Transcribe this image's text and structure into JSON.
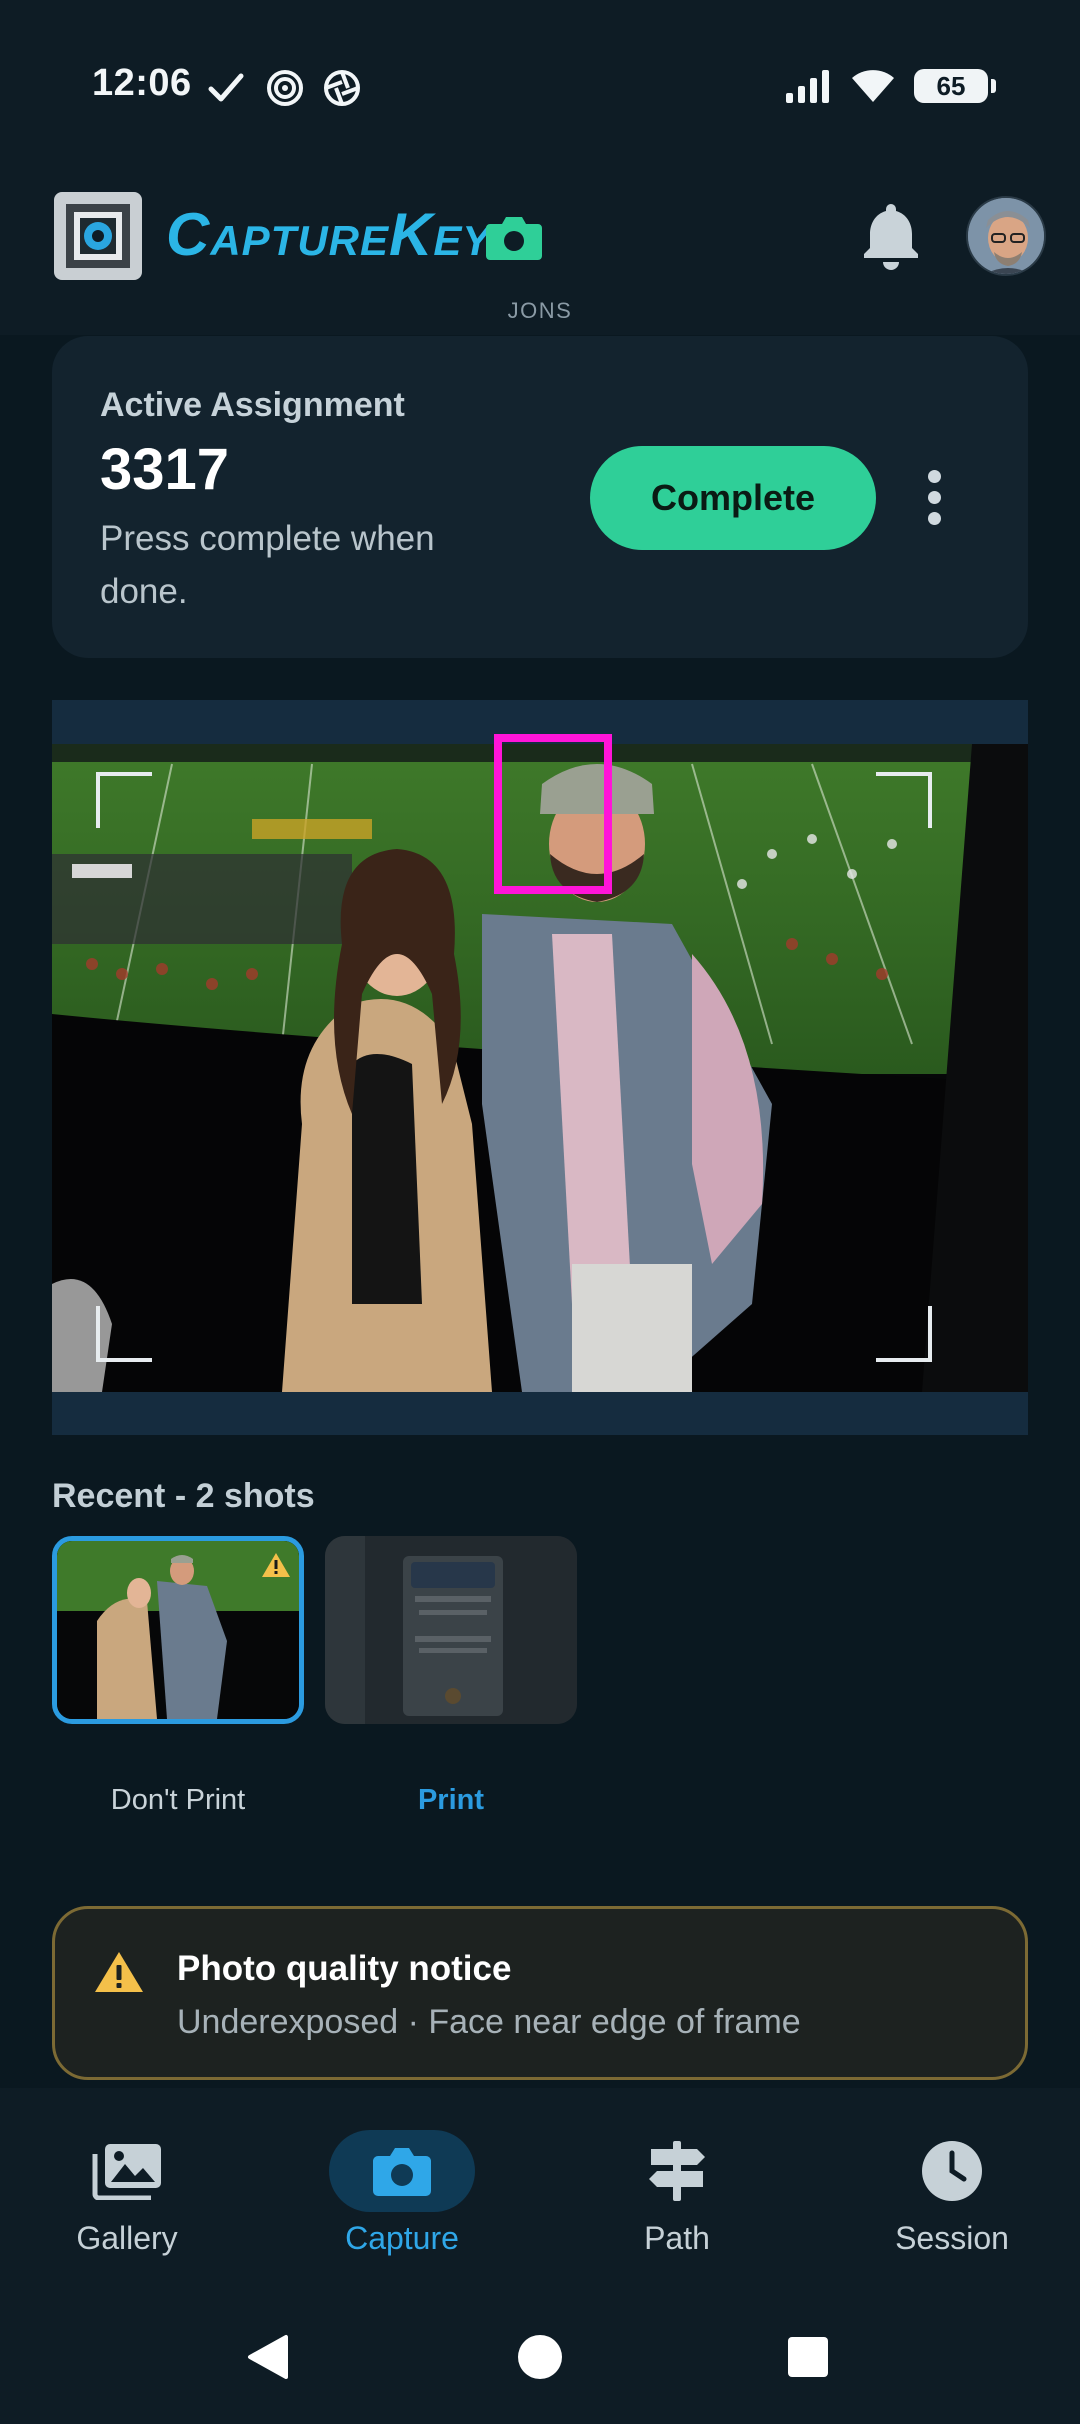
{
  "status_bar": {
    "time": "12:06",
    "battery": "65"
  },
  "header": {
    "brand": "CaptureKey",
    "org": "JONS"
  },
  "assignment": {
    "label": "Active Assignment",
    "number": "3317",
    "description": "Press complete when done.",
    "complete_label": "Complete"
  },
  "recent": {
    "title": "Recent - 2 shots",
    "shots": [
      {
        "caption": "Don't Print",
        "warning": true
      },
      {
        "caption": "Print",
        "warning": false
      }
    ]
  },
  "notice": {
    "title": "Photo quality notice",
    "body": "Underexposed · Face near edge of frame"
  },
  "nav": {
    "items": [
      {
        "label": "Gallery",
        "icon": "gallery-icon",
        "active": false
      },
      {
        "label": "Capture",
        "icon": "camera-icon",
        "active": true
      },
      {
        "label": "Path",
        "icon": "signpost-icon",
        "active": false
      },
      {
        "label": "Session",
        "icon": "clock-icon",
        "active": false
      }
    ]
  },
  "colors": {
    "accent": "#2fa7e8",
    "complete": "#2fcf98",
    "face_box": "#ff14d8",
    "warning": "#f4c04a"
  }
}
